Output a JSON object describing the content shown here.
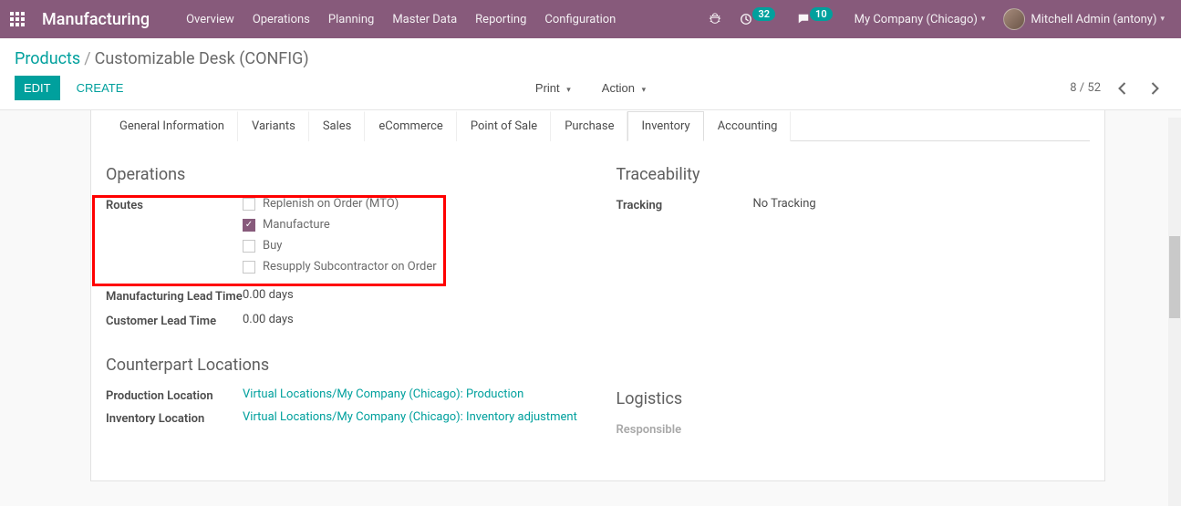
{
  "nav": {
    "brand": "Manufacturing",
    "menu": [
      "Overview",
      "Operations",
      "Planning",
      "Master Data",
      "Reporting",
      "Configuration"
    ],
    "activity_count": "32",
    "message_count": "10",
    "company": "My Company (Chicago)",
    "user": "Mitchell Admin (antony)"
  },
  "breadcrumb": {
    "root": "Products",
    "current": "Customizable Desk (CONFIG)"
  },
  "buttons": {
    "edit": "EDIT",
    "create": "CREATE",
    "print": "Print",
    "action": "Action"
  },
  "pager": {
    "position": "8 / 52"
  },
  "tabs": [
    "General Information",
    "Variants",
    "Sales",
    "eCommerce",
    "Point of Sale",
    "Purchase",
    "Inventory",
    "Accounting"
  ],
  "active_tab_index": 6,
  "sections": {
    "operations": {
      "title": "Operations",
      "routes_label": "Routes",
      "routes": [
        {
          "label": "Replenish on Order (MTO)",
          "checked": false
        },
        {
          "label": "Manufacture",
          "checked": true
        },
        {
          "label": "Buy",
          "checked": false
        },
        {
          "label": "Resupply Subcontractor on Order",
          "checked": false
        }
      ],
      "mfg_lead_label": "Manufacturing Lead Time",
      "mfg_lead_value": "0.00 days",
      "cust_lead_label": "Customer Lead Time",
      "cust_lead_value": "0.00 days"
    },
    "traceability": {
      "title": "Traceability",
      "tracking_label": "Tracking",
      "tracking_value": "No Tracking"
    },
    "counterpart": {
      "title": "Counterpart Locations",
      "prod_loc_label": "Production Location",
      "prod_loc_value": "Virtual Locations/My Company (Chicago): Production",
      "inv_loc_label": "Inventory Location",
      "inv_loc_value": "Virtual Locations/My Company (Chicago): Inventory adjustment"
    },
    "logistics": {
      "title": "Logistics",
      "responsible_label": "Responsible"
    }
  }
}
